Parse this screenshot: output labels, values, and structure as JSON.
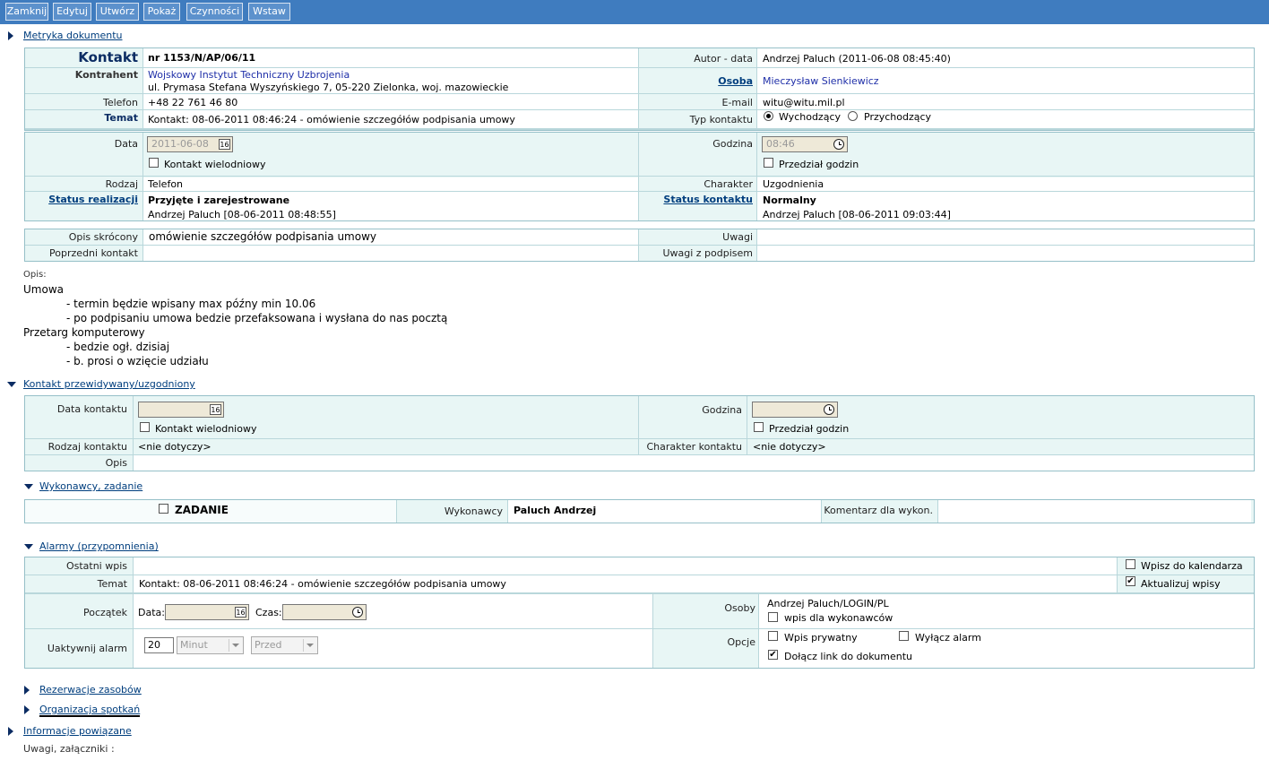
{
  "toolbar": {
    "buttons": [
      "Zamknij",
      "Edytuj",
      "Utwórz",
      "Pokaż",
      "Czynności",
      "Wstaw"
    ]
  },
  "colors": {
    "toolbar_bg": "#3f7cbf",
    "panel_bg": "#e8f6f5",
    "panel_border": "#96c0c8",
    "link": "#003e7e",
    "blue_text": "#1f2fa8"
  },
  "sections": {
    "metryka": "Metryka dokumentu",
    "kontakt_przew": "Kontakt przewidywany/uzgodniony",
    "wykonawcy": "Wykonawcy, zadanie",
    "alarmy": "Alarmy (przypomnienia)",
    "rezerwacje": "Rezerwacje zasobów",
    "organizacja": "Organizacja spotkań",
    "informacje": "Informacje powiązane"
  },
  "metryka": {
    "kontakt_label": "Kontakt",
    "kontakt_nr": "nr 1153/N/AP/06/11",
    "autor_label": "Autor - data",
    "autor_value": "Andrzej Paluch (2011-06-08 08:45:40)",
    "kontrahent_label": "Kontrahent",
    "kontrahent_name": "Wojskowy Instytut Techniczny Uzbrojenia",
    "kontrahent_addr": "ul. Prymasa Stefana Wyszyńskiego 7, 05-220 Zielonka, woj. mazowieckie",
    "osoba_label": "Osoba",
    "osoba_value": "Mieczysław Sienkiewicz",
    "telefon_label": "Telefon",
    "telefon_value": "+48 22 761 46 80",
    "email_label": "E-mail",
    "email_value": "witu@witu.mil.pl",
    "temat_label": "Temat",
    "temat_value": "Kontakt: 08-06-2011 08:46:24 - omówienie szczegółów podpisania umowy",
    "typ_label": "Typ kontaktu",
    "typ_options": [
      "Wychodzący",
      "Przychodzący"
    ],
    "typ_selected": "Wychodzący"
  },
  "dane": {
    "data_label": "Data",
    "data_value": "2011-06-08",
    "wielodniowy_label": "Kontakt wielodniowy",
    "godzina_label": "Godzina",
    "godzina_value": "08:46",
    "przedzial_label": "Przedział godzin",
    "rodzaj_label": "Rodzaj",
    "rodzaj_value": "Telefon",
    "charakter_label": "Charakter",
    "charakter_value": "Uzgodnienia",
    "status_real_label": "Status realizacji",
    "status_real_value": "Przyjęte i zarejestrowane",
    "status_real_by": "Andrzej Paluch [08-06-2011 08:48:55]",
    "status_kont_label": "Status kontaktu",
    "status_kont_value": "Normalny",
    "status_kont_by": "Andrzej Paluch [08-06-2011 09:03:44]"
  },
  "opisy": {
    "opis_skr_label": "Opis skrócony",
    "opis_skr_value": "omówienie szczegółów podpisania umowy",
    "uwagi_label": "Uwagi",
    "poprzedni_label": "Poprzedni kontakt",
    "uwagi_podpis_label": "Uwagi z podpisem"
  },
  "opis": {
    "label": "Opis:",
    "lines": [
      "Umowa",
      "- termin będzie wpisany max późny min 10.06",
      "- po podpisaniu umowa bedzie przefaksowana i wysłana do nas pocztą",
      "Przetarg komputerowy",
      "- bedzie ogł. dzisiaj",
      "- b. prosi o wzięcie udziału"
    ]
  },
  "kontakt_przew": {
    "data_label": "Data kontaktu",
    "godzina_label": "Godzina",
    "wielodniowy_label": "Kontakt wielodniowy",
    "przedzial_label": "Przedział godzin",
    "rodzaj_label": "Rodzaj kontaktu",
    "rodzaj_value": "<nie dotyczy>",
    "charakter_label": "Charakter kontaktu",
    "charakter_value": "<nie dotyczy>",
    "opis_label": "Opis"
  },
  "wykonawcy": {
    "zadanie_label": "ZADANIE",
    "wykonawcy_label": "Wykonawcy",
    "wykonawcy_value": "Paluch Andrzej",
    "komentarz_label": "Komentarz dla wykon."
  },
  "alarmy": {
    "ostatni_label": "Ostatni wpis",
    "wpisz_kal_label": "Wpisz do kalendarza",
    "temat_label": "Temat",
    "temat_value": "Kontakt: 08-06-2011 08:46:24 - omówienie szczegółów podpisania umowy",
    "aktualizuj_label": "Aktualizuj wpisy",
    "poczatek_label": "Początek",
    "data_label": "Data:",
    "czas_label": "Czas:",
    "osoby_label": "Osoby",
    "osoby_value": "Andrzej Paluch/LOGIN/PL",
    "wpis_wyk_label": "wpis dla wykonawców",
    "uaktywnij_label": "Uaktywnij alarm",
    "uaktywnij_value": "20",
    "minut_value": "Minut",
    "przed_value": "Przed",
    "opcje_label": "Opcje",
    "wpis_prywatny_label": "Wpis prywatny",
    "wylacz_label": "Wyłącz alarm",
    "dolacz_label": "Dołącz link do dokumentu"
  },
  "uwagi_zal": "Uwagi, załączniki :"
}
